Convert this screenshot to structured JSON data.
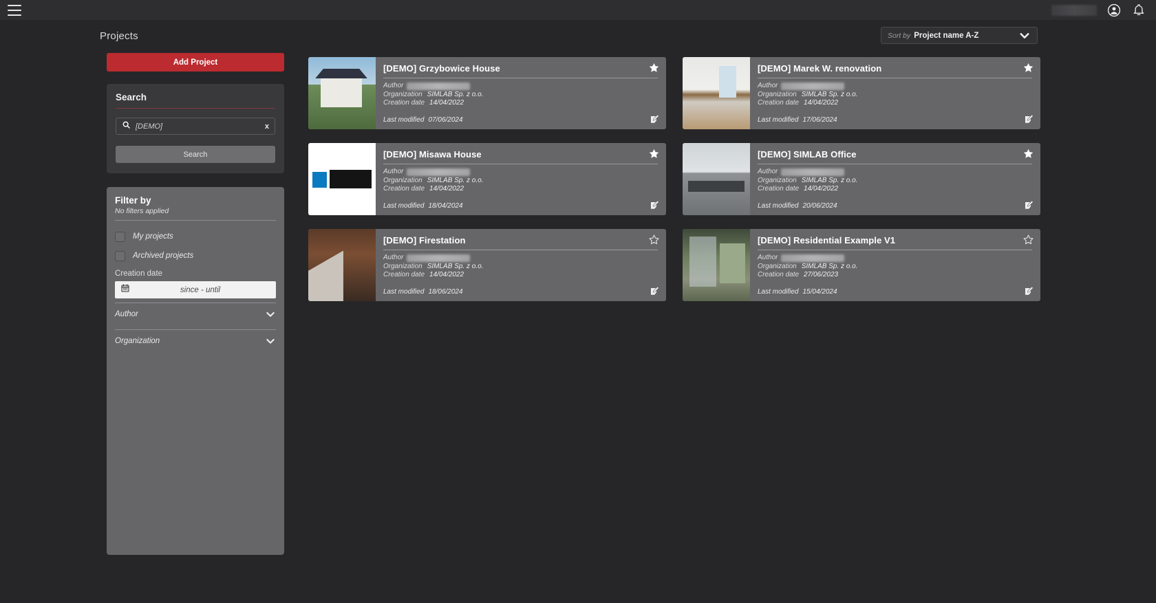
{
  "topbar": {
    "menu_icon": "hamburger-icon",
    "user_field_redacted": true,
    "account_icon": "account-circle-icon",
    "notifications_icon": "bell-icon"
  },
  "header": {
    "page_title": "Projects"
  },
  "sort": {
    "label": "Sort by",
    "value": "Project name A-Z",
    "caret_icon": "chevron-down-icon"
  },
  "sidebar": {
    "add_project_label": "Add Project",
    "search": {
      "title": "Search",
      "icon": "search-icon",
      "value": "[DEMO]",
      "placeholder": "[DEMO]",
      "clear_label": "x",
      "button_label": "Search"
    },
    "filter": {
      "title": "Filter by",
      "subtitle": "No filters applied",
      "checkboxes": [
        {
          "label": "My projects",
          "checked": false
        },
        {
          "label": "Archived projects",
          "checked": false
        }
      ],
      "creation_date": {
        "label": "Creation date",
        "icon": "calendar-icon",
        "placeholder": "since - until",
        "value": "since - until"
      },
      "accordions": [
        {
          "label": "Author",
          "icon": "chevron-down-icon",
          "expanded": false
        },
        {
          "label": "Organization",
          "icon": "chevron-down-icon",
          "expanded": false
        }
      ]
    }
  },
  "main": {
    "meta_labels": {
      "author": "Author",
      "organization": "Organization",
      "creation_date": "Creation date",
      "last_modified": "Last modified"
    },
    "projects": [
      {
        "title": "[DEMO] Grzybowice House",
        "author_redacted": true,
        "organization": "SIMLAB Sp. z o.o.",
        "creation_date": "14/04/2022",
        "last_modified": "07/06/2024",
        "favorite": true,
        "thumb": "art-house"
      },
      {
        "title": "[DEMO] Marek W. renovation",
        "author_redacted": true,
        "organization": "SIMLAB Sp. z o.o.",
        "creation_date": "14/04/2022",
        "last_modified": "17/06/2024",
        "favorite": true,
        "thumb": "art-kitchen"
      },
      {
        "title": "[DEMO] Misawa House",
        "author_redacted": true,
        "organization": "SIMLAB Sp. z o.o.",
        "creation_date": "14/04/2022",
        "last_modified": "18/04/2024",
        "favorite": true,
        "thumb": "art-misawa"
      },
      {
        "title": "[DEMO] SIMLAB Office",
        "author_redacted": true,
        "organization": "SIMLAB Sp. z o.o.",
        "creation_date": "14/04/2022",
        "last_modified": "20/06/2024",
        "favorite": true,
        "thumb": "art-office"
      },
      {
        "title": "[DEMO] Firestation",
        "author_redacted": true,
        "organization": "SIMLAB Sp. z o.o.",
        "creation_date": "14/04/2022",
        "last_modified": "18/06/2024",
        "favorite": false,
        "thumb": "art-fire"
      },
      {
        "title": "[DEMO] Residential Example V1",
        "author_redacted": true,
        "organization": "SIMLAB Sp. z o.o.",
        "creation_date": "27/06/2023",
        "last_modified": "15/04/2024",
        "favorite": false,
        "thumb": "art-resi"
      }
    ]
  },
  "colors": {
    "accent_red": "#bb2b30",
    "app_background": "#262628",
    "topbar": "#2e2e30",
    "panel": "#39393b",
    "filter_panel": "#666668",
    "card": "#666668"
  }
}
